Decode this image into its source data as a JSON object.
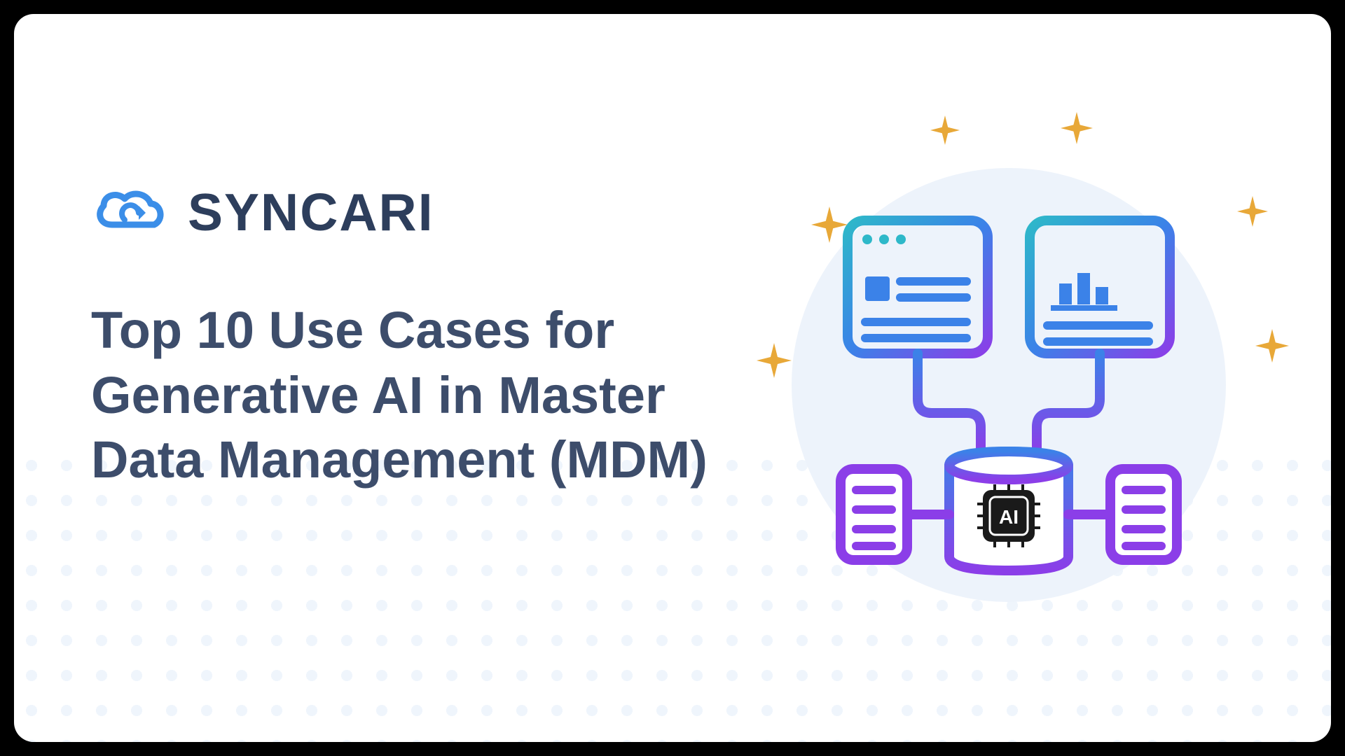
{
  "brand": "SYNCARI",
  "headline": "Top 10 Use Cases for Generative AI in Master Data Management (MDM)",
  "illustration": {
    "ai_label": "AI"
  },
  "colors": {
    "brand_icon": "#3b8ee8",
    "text_primary": "#3d4d6b",
    "text_brand": "#2d3e5c",
    "gradient_start": "#2eb8c9",
    "gradient_mid": "#3b82e8",
    "gradient_end": "#8b3ee8",
    "sparkle": "#e8a838",
    "circle_bg": "#edf3fb",
    "dots": "#e8f0fb"
  }
}
